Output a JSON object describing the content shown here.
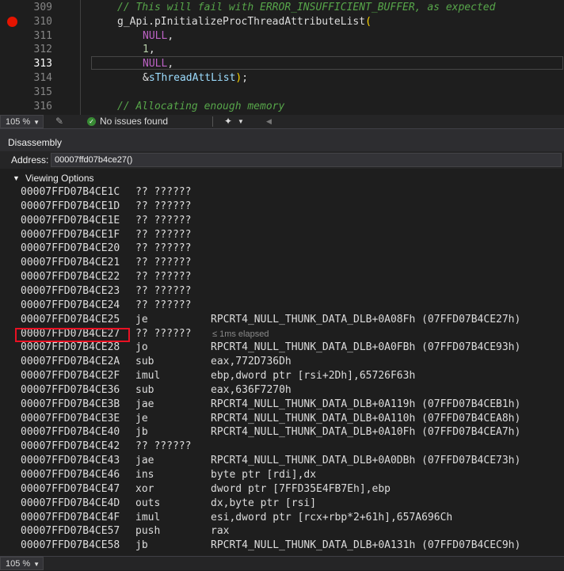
{
  "editor": {
    "lines": [
      {
        "num": "309",
        "parts": [
          {
            "cls": "cm",
            "t": "// This will fail with ERROR_INSUFFICIENT_BUFFER, as expected"
          }
        ],
        "indent": 148
      },
      {
        "num": "310",
        "parts": [
          {
            "cls": "fn",
            "t": "g_Api.pInitializeProcThreadAttributeList"
          },
          {
            "cls": "paren",
            "t": "("
          }
        ],
        "indent": 148
      },
      {
        "num": "311",
        "parts": [
          {
            "cls": "kw",
            "t": "NULL"
          },
          {
            "cls": "fn",
            "t": ","
          }
        ],
        "indent": 180
      },
      {
        "num": "312",
        "parts": [
          {
            "cls": "num",
            "t": "1"
          },
          {
            "cls": "fn",
            "t": ","
          }
        ],
        "indent": 180
      },
      {
        "num": "313",
        "parts": [
          {
            "cls": "kw",
            "t": "NULL"
          },
          {
            "cls": "fn",
            "t": ","
          }
        ],
        "indent": 180
      },
      {
        "num": "314",
        "parts": [
          {
            "cls": "amp",
            "t": "&"
          },
          {
            "cls": "var",
            "t": "sThreadAttList"
          },
          {
            "cls": "paren",
            "t": ")"
          },
          {
            "cls": "fn",
            "t": ";"
          }
        ],
        "indent": 180
      },
      {
        "num": "315",
        "parts": [],
        "indent": 148
      },
      {
        "num": "316",
        "parts": [
          {
            "cls": "cm",
            "t": "// Allocating enough memory"
          }
        ],
        "indent": 148
      }
    ],
    "current_line": "313",
    "breakpoint_line": "310"
  },
  "editor_status": {
    "zoom": "105 %",
    "issues": "No issues found"
  },
  "disassembly": {
    "title": "Disassembly",
    "address_label": "Address:",
    "address_value": "00007ffd07b4ce27()",
    "viewing_options": "Viewing Options",
    "rows": [
      {
        "addr": "00007FFD07B4CE1C",
        "mn": "?? ??????",
        "op": ""
      },
      {
        "addr": "00007FFD07B4CE1D",
        "mn": "?? ??????",
        "op": ""
      },
      {
        "addr": "00007FFD07B4CE1E",
        "mn": "?? ??????",
        "op": ""
      },
      {
        "addr": "00007FFD07B4CE1F",
        "mn": "?? ??????",
        "op": ""
      },
      {
        "addr": "00007FFD07B4CE20",
        "mn": "?? ??????",
        "op": ""
      },
      {
        "addr": "00007FFD07B4CE21",
        "mn": "?? ??????",
        "op": ""
      },
      {
        "addr": "00007FFD07B4CE22",
        "mn": "?? ??????",
        "op": ""
      },
      {
        "addr": "00007FFD07B4CE23",
        "mn": "?? ??????",
        "op": ""
      },
      {
        "addr": "00007FFD07B4CE24",
        "mn": "?? ??????",
        "op": ""
      },
      {
        "addr": "00007FFD07B4CE25",
        "mn": "je",
        "op": "RPCRT4_NULL_THUNK_DATA_DLB+0A08Fh (07FFD07B4CE27h)"
      },
      {
        "addr": "00007FFD07B4CE27",
        "mn": "?? ??????",
        "op": "",
        "note": "≤ 1ms elapsed"
      },
      {
        "addr": "00007FFD07B4CE28",
        "mn": "jo",
        "op": "RPCRT4_NULL_THUNK_DATA_DLB+0A0FBh (07FFD07B4CE93h)"
      },
      {
        "addr": "00007FFD07B4CE2A",
        "mn": "sub",
        "op": "eax,772D736Dh"
      },
      {
        "addr": "00007FFD07B4CE2F",
        "mn": "imul",
        "op": "ebp,dword ptr [rsi+2Dh],65726F63h"
      },
      {
        "addr": "00007FFD07B4CE36",
        "mn": "sub",
        "op": "eax,636F7270h"
      },
      {
        "addr": "00007FFD07B4CE3B",
        "mn": "jae",
        "op": "RPCRT4_NULL_THUNK_DATA_DLB+0A119h (07FFD07B4CEB1h)"
      },
      {
        "addr": "00007FFD07B4CE3E",
        "mn": "je",
        "op": "RPCRT4_NULL_THUNK_DATA_DLB+0A110h (07FFD07B4CEA8h)"
      },
      {
        "addr": "00007FFD07B4CE40",
        "mn": "jb",
        "op": "RPCRT4_NULL_THUNK_DATA_DLB+0A10Fh (07FFD07B4CEA7h)"
      },
      {
        "addr": "00007FFD07B4CE42",
        "mn": "?? ??????",
        "op": ""
      },
      {
        "addr": "00007FFD07B4CE43",
        "mn": "jae",
        "op": "RPCRT4_NULL_THUNK_DATA_DLB+0A0DBh (07FFD07B4CE73h)"
      },
      {
        "addr": "00007FFD07B4CE46",
        "mn": "ins",
        "op": "byte ptr [rdi],dx"
      },
      {
        "addr": "00007FFD07B4CE47",
        "mn": "xor",
        "op": "dword ptr [7FFD35E4FB7Eh],ebp"
      },
      {
        "addr": "00007FFD07B4CE4D",
        "mn": "outs",
        "op": "dx,byte ptr [rsi]"
      },
      {
        "addr": "00007FFD07B4CE4F",
        "mn": "imul",
        "op": "esi,dword ptr [rcx+rbp*2+61h],657A696Ch"
      },
      {
        "addr": "00007FFD07B4CE57",
        "mn": "push",
        "op": "rax"
      },
      {
        "addr": "00007FFD07B4CE58",
        "mn": "jb",
        "op": "RPCRT4_NULL_THUNK_DATA_DLB+0A131h (07FFD07B4CEC9h)"
      }
    ],
    "bottom_zoom": "105 %"
  }
}
